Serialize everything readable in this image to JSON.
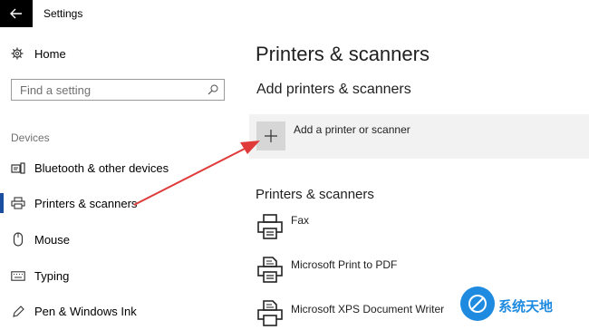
{
  "window": {
    "title": "Settings"
  },
  "sidebar": {
    "home_label": "Home",
    "search_placeholder": "Find a setting",
    "section_label": "Devices",
    "items": [
      {
        "label": "Bluetooth & other devices",
        "icon": "bluetooth-devices-icon"
      },
      {
        "label": "Printers & scanners",
        "icon": "printer-icon",
        "selected": true
      },
      {
        "label": "Mouse",
        "icon": "mouse-icon"
      },
      {
        "label": "Typing",
        "icon": "keyboard-icon"
      },
      {
        "label": "Pen & Windows Ink",
        "icon": "pen-icon"
      }
    ]
  },
  "main": {
    "page_title": "Printers & scanners",
    "add_section_title": "Add printers & scanners",
    "add_button_label": "Add a printer or scanner",
    "list_title": "Printers & scanners",
    "printers": [
      {
        "name": "Fax",
        "icon": "printer-icon"
      },
      {
        "name": "Microsoft Print to PDF",
        "icon": "document-printer-icon"
      },
      {
        "name": "Microsoft XPS Document Writer",
        "icon": "document-printer-icon"
      }
    ]
  },
  "annotation": {
    "arrow_color": "#e03a3a"
  },
  "watermark": {
    "text": "系统天地"
  },
  "colors": {
    "accent": "#1a4fa0",
    "panel": "#f2f2f2",
    "button": "#d6d6d6"
  }
}
